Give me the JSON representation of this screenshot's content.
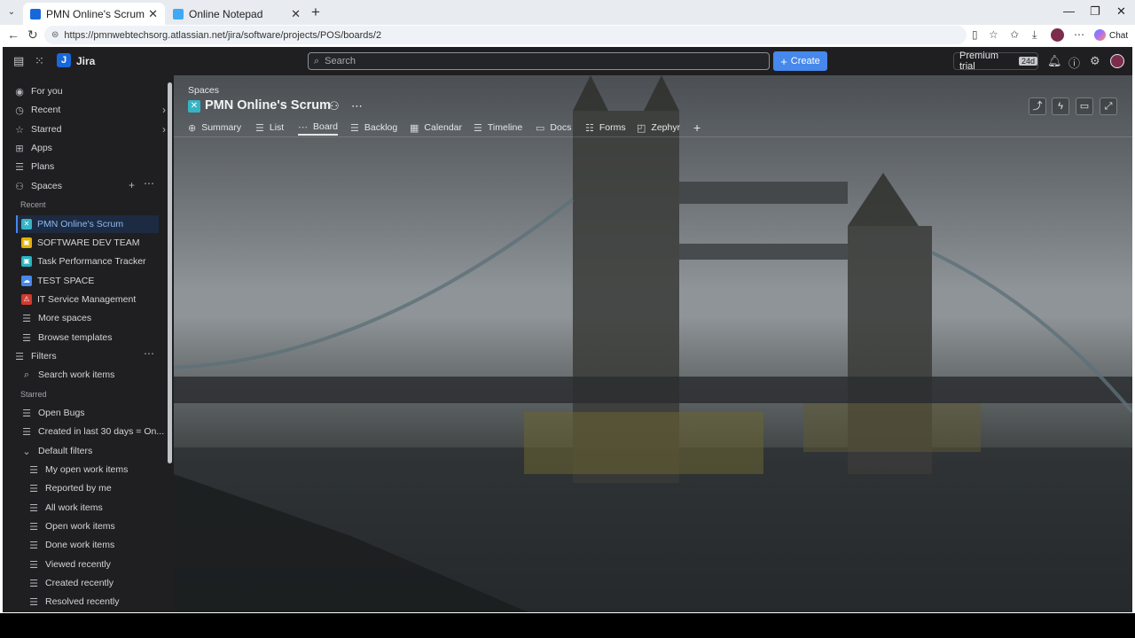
{
  "browser": {
    "tabs": [
      {
        "title": "PMN Online's Scrum - Backlog - Jira",
        "active": true,
        "favicon_color": "#1868db"
      },
      {
        "title": "Online Notepad",
        "active": false,
        "favicon_color": "#3fa9f5"
      }
    ],
    "url": "https://pmnwebtechsorg.atlassian.net/jira/software/projects/POS/boards/2",
    "chat_label": "Chat"
  },
  "jira": {
    "app_name": "Jira",
    "search_placeholder": "Search",
    "create_label": "Create",
    "premium_label": "Premium trial",
    "premium_badge": "24d"
  },
  "sidebar": {
    "top_items": [
      {
        "label": "For you",
        "icon": "user-circle-icon"
      },
      {
        "label": "Recent",
        "icon": "clock-icon"
      },
      {
        "label": "Starred",
        "icon": "star-icon"
      },
      {
        "label": "Apps",
        "icon": "apps-grid-icon"
      },
      {
        "label": "Plans",
        "icon": "plans-icon"
      },
      {
        "label": "Spaces",
        "icon": "spaces-icon"
      }
    ],
    "recent_label": "Recent",
    "spaces": [
      {
        "label": "PMN Online's Scrum",
        "color": "#37b4c3"
      },
      {
        "label": "SOFTWARE DEV TEAM",
        "color": "#e2b203"
      },
      {
        "label": "Task Performance Tracker",
        "color": "#2ab3c1"
      },
      {
        "label": "TEST SPACE",
        "color": "#4688ec"
      },
      {
        "label": "IT Service Management",
        "color": "#d13a2f"
      }
    ],
    "more_spaces": "More spaces",
    "browse_templates": "Browse templates",
    "filters_label": "Filters",
    "search_work_items": "Search work items",
    "starred_label": "Starred",
    "starred_filters": [
      "Open Bugs",
      "Created in last 30 days = On..."
    ],
    "default_filters_label": "Default filters",
    "default_filters": [
      "My open work items",
      "Reported by me",
      "All work items",
      "Open work items",
      "Done work items",
      "Viewed recently",
      "Created recently",
      "Resolved recently"
    ]
  },
  "project": {
    "breadcrumb": "Spaces",
    "title": "PMN Online's Scrum",
    "tabs": [
      {
        "label": "Summary",
        "icon": "globe-icon"
      },
      {
        "label": "List",
        "icon": "list-icon"
      },
      {
        "label": "Board",
        "icon": "board-icon"
      },
      {
        "label": "Backlog",
        "icon": "backlog-icon"
      },
      {
        "label": "Calendar",
        "icon": "calendar-icon"
      },
      {
        "label": "Timeline",
        "icon": "timeline-icon"
      },
      {
        "label": "Docs",
        "icon": "docs-icon"
      },
      {
        "label": "Forms",
        "icon": "forms-icon"
      },
      {
        "label": "Zephyr",
        "icon": "zephyr-icon"
      }
    ],
    "active_tab": "Board"
  }
}
